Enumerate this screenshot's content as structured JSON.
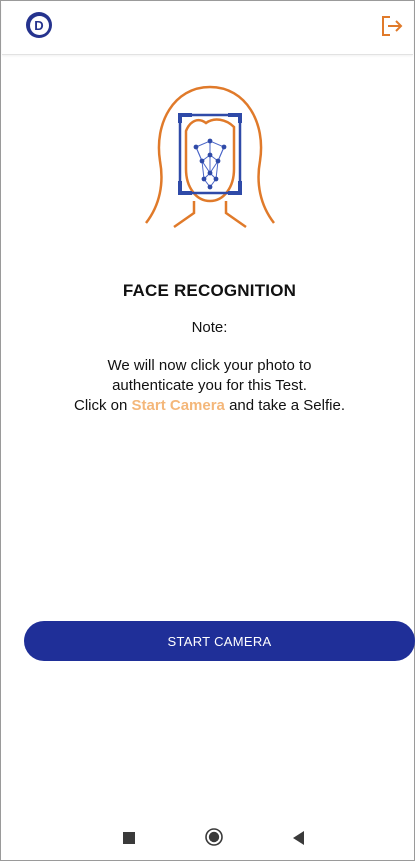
{
  "header": {
    "logo_letter": "D",
    "logo_icon": "brand-logo",
    "logout_icon": "logout-icon",
    "brand_color": "#25338e",
    "accent_color": "#e07a2a"
  },
  "illustration": {
    "icon": "face-recognition-icon"
  },
  "content": {
    "title": "FACE RECOGNITION",
    "note_label": "Note:",
    "line1": "We will now click your photo to",
    "line2": "authenticate you for this Test.",
    "line3_prefix": "Click on",
    "line3_link": "Start Camera",
    "line3_suffix": "and take a Selfie."
  },
  "actions": {
    "start_camera_label": "START CAMERA"
  },
  "system_nav": {
    "recents_icon": "square-icon",
    "home_icon": "circle-icon",
    "back_icon": "back-triangle-icon"
  }
}
